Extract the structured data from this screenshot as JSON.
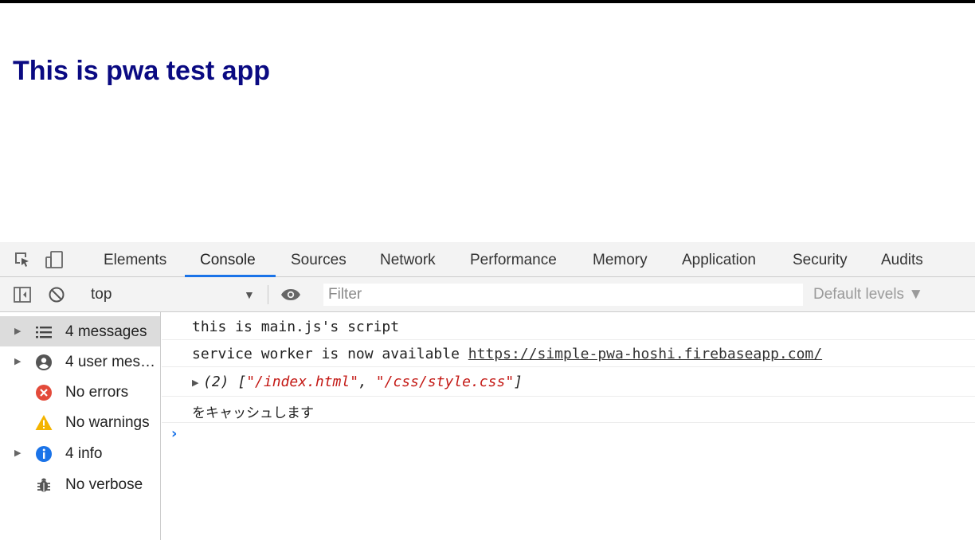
{
  "page": {
    "heading": "This is pwa test app"
  },
  "devtools": {
    "tabs": [
      {
        "label": "Elements"
      },
      {
        "label": "Console"
      },
      {
        "label": "Sources"
      },
      {
        "label": "Network"
      },
      {
        "label": "Performance"
      },
      {
        "label": "Memory"
      },
      {
        "label": "Application"
      },
      {
        "label": "Security"
      },
      {
        "label": "Audits"
      }
    ],
    "active_tab": "Console",
    "toolbar": {
      "context": "top",
      "select_arrow": "▼",
      "filter_placeholder": "Filter",
      "levels": "Default levels ▼"
    },
    "sidebar": [
      {
        "label": "4 messages",
        "icon": "list-icon",
        "expandable": true,
        "selected": true
      },
      {
        "label": "4 user mes…",
        "icon": "user-icon",
        "expandable": true,
        "selected": false
      },
      {
        "label": "No errors",
        "icon": "error-icon",
        "expandable": false,
        "selected": false
      },
      {
        "label": "No warnings",
        "icon": "warning-icon",
        "expandable": false,
        "selected": false
      },
      {
        "label": "4 info",
        "icon": "info-icon",
        "expandable": true,
        "selected": false
      },
      {
        "label": "No verbose",
        "icon": "bug-icon",
        "expandable": false,
        "selected": false
      }
    ],
    "console": {
      "line1": "this is main.js's script",
      "line2_text": "service worker is now available ",
      "line2_link": "https://simple-pwa-hoshi.firebaseapp.com/",
      "line3_prefix": "(2) [",
      "line3_item1": "\"/index.html\"",
      "line3_sep": ", ",
      "line3_item2": "\"/css/style.css\"",
      "line3_suffix": "]",
      "line4": "をキャッシュします",
      "prompt": "›"
    }
  },
  "colors": {
    "heading": "#0a0a82",
    "accent": "#1a73e8",
    "string": "#c41a16",
    "error": "#e34a3a",
    "warning": "#f4b400",
    "info": "#1a73e8"
  }
}
